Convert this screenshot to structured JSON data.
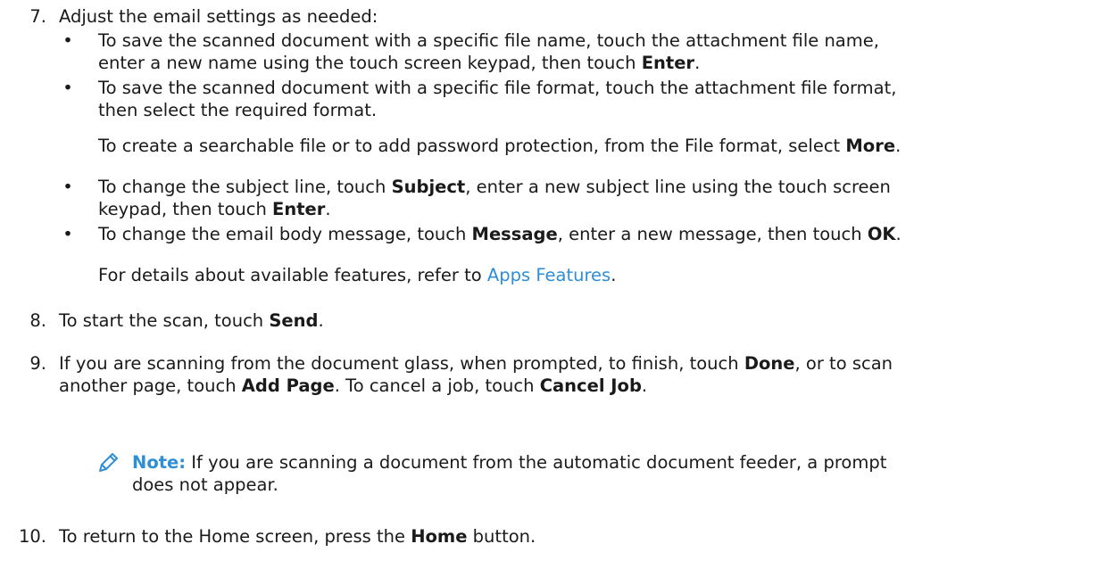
{
  "step7": {
    "num": "7.",
    "text": "Adjust the email settings as needed:",
    "bullets": [
      {
        "dot": "•",
        "line1": "To save the scanned document with a specific file name, touch the attachment file name,",
        "line2_pre": "enter a new name using the touch screen keypad, then touch ",
        "line2_bold": "Enter",
        "line2_post": "."
      },
      {
        "dot": "•",
        "line1": "To save the scanned document with a specific file format, touch the attachment file format,",
        "line2": "then select the required format."
      }
    ],
    "para1_pre": "To create a searchable file or to add password protection, from the File format, select ",
    "para1_bold": "More",
    "para1_post": ".",
    "bullets2": [
      {
        "dot": "•",
        "line1_pre": "To change the subject line, touch ",
        "line1_bold": "Subject",
        "line1_post": ", enter a new subject line using the touch screen",
        "line2_pre": "keypad, then touch ",
        "line2_bold": "Enter",
        "line2_post": "."
      },
      {
        "dot": "•",
        "line1_pre": "To change the email body message, touch ",
        "line1_bold": "Message",
        "line1_mid": ", enter a new message, then touch ",
        "line1_bold2": "OK",
        "line1_post": "."
      }
    ],
    "para2_pre": "For details about available features, refer to ",
    "para2_link": "Apps Features",
    "para2_post": "."
  },
  "step8": {
    "num": "8.",
    "pre": "To start the scan, touch ",
    "bold": "Send",
    "post": "."
  },
  "step9": {
    "num": "9.",
    "line1_pre": "If you are scanning from the document glass, when prompted, to finish, touch ",
    "line1_bold": "Done",
    "line1_post": ", or to scan",
    "line2_pre": "another page, touch ",
    "line2_bold": "Add Page",
    "line2_mid": ". To cancel a job, touch ",
    "line2_bold2": "Cancel Job",
    "line2_post": "."
  },
  "note": {
    "icon": "pencil-icon",
    "label": "Note:",
    "line1": " If you are scanning a document from the automatic document feeder, a prompt",
    "line2": "does not appear.",
    "color": "#2e8fd6"
  },
  "step10": {
    "num": "10.",
    "pre": "To return to the Home screen, press the ",
    "bold": "Home",
    "post": " button."
  }
}
